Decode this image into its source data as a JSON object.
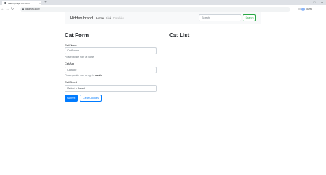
{
  "browser": {
    "tab_title": "Leaving Page Cat Form",
    "url": "localhost:3000",
    "profile_label": "Guest"
  },
  "navbar": {
    "brand": "Hidden brand",
    "links": [
      {
        "label": "Home",
        "state": "active"
      },
      {
        "label": "Link",
        "state": "normal"
      },
      {
        "label": "Disabled",
        "state": "disabled"
      }
    ],
    "search_placeholder": "Search",
    "search_button": "Search"
  },
  "form": {
    "heading": "Cat Form",
    "name_label": "Cat Name",
    "name_placeholder": "Cat Name",
    "name_help": "Please provide your cat name.",
    "age_label": "Cat Age",
    "age_placeholder": "Cat Age",
    "age_help_prefix": "Please provide your cat age in",
    "age_help_bold": "month",
    "age_help_suffix": ".",
    "breed_label": "Cat Breed",
    "breed_selected": "Select a Breed",
    "submit_label": "Submit",
    "clear_label": "Clear Cookies"
  },
  "list": {
    "heading": "Cat List"
  },
  "colors": {
    "primary": "#007bff",
    "success": "#28a745",
    "navbar_bg": "#f8f9fa"
  }
}
